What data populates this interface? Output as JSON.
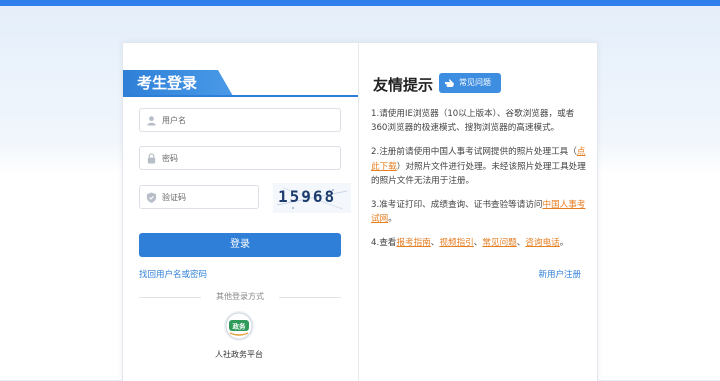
{
  "login": {
    "tab_title": "考生登录",
    "username_placeholder": "用户名",
    "password_placeholder": "密码",
    "captcha_placeholder": "验证码",
    "captcha_text": "15968",
    "login_button": "登录",
    "forgot_link": "找回用户名或密码",
    "register_link": "新用户注册",
    "other_methods": "其他登录方式",
    "gov_platform_label": "人社政务平台",
    "gov_logo_text": "政务"
  },
  "info": {
    "title": "友情提示",
    "faq_badge": "常见问题",
    "tip1": "1.请使用IE浏览器（10以上版本）、谷歌浏览器，或者360浏览器的极速模式、搜狗浏览器的高速模式。",
    "tip2_a": "2.注册前请使用中国人事考试网提供的照片处理工具（",
    "tip2_link": "点此下载",
    "tip2_b": "）对照片文件进行处理。未经该照片处理工具处理的照片文件无法用于注册。",
    "tip3_a": "3.准考证打印、成绩查询、证书查验等请访问",
    "tip3_link": "中国人事考试网",
    "tip3_b": "。",
    "tip4_a": "4.查看",
    "tip4_link1": "报考指南",
    "tip4_sep1": "、",
    "tip4_link2": "视频指引",
    "tip4_sep2": "、",
    "tip4_link3": "常见问题",
    "tip4_sep3": "、",
    "tip4_link4": "咨询电话",
    "tip4_end": "。"
  },
  "colors": {
    "primary": "#2f7fd8",
    "link_orange": "#e67e22"
  }
}
